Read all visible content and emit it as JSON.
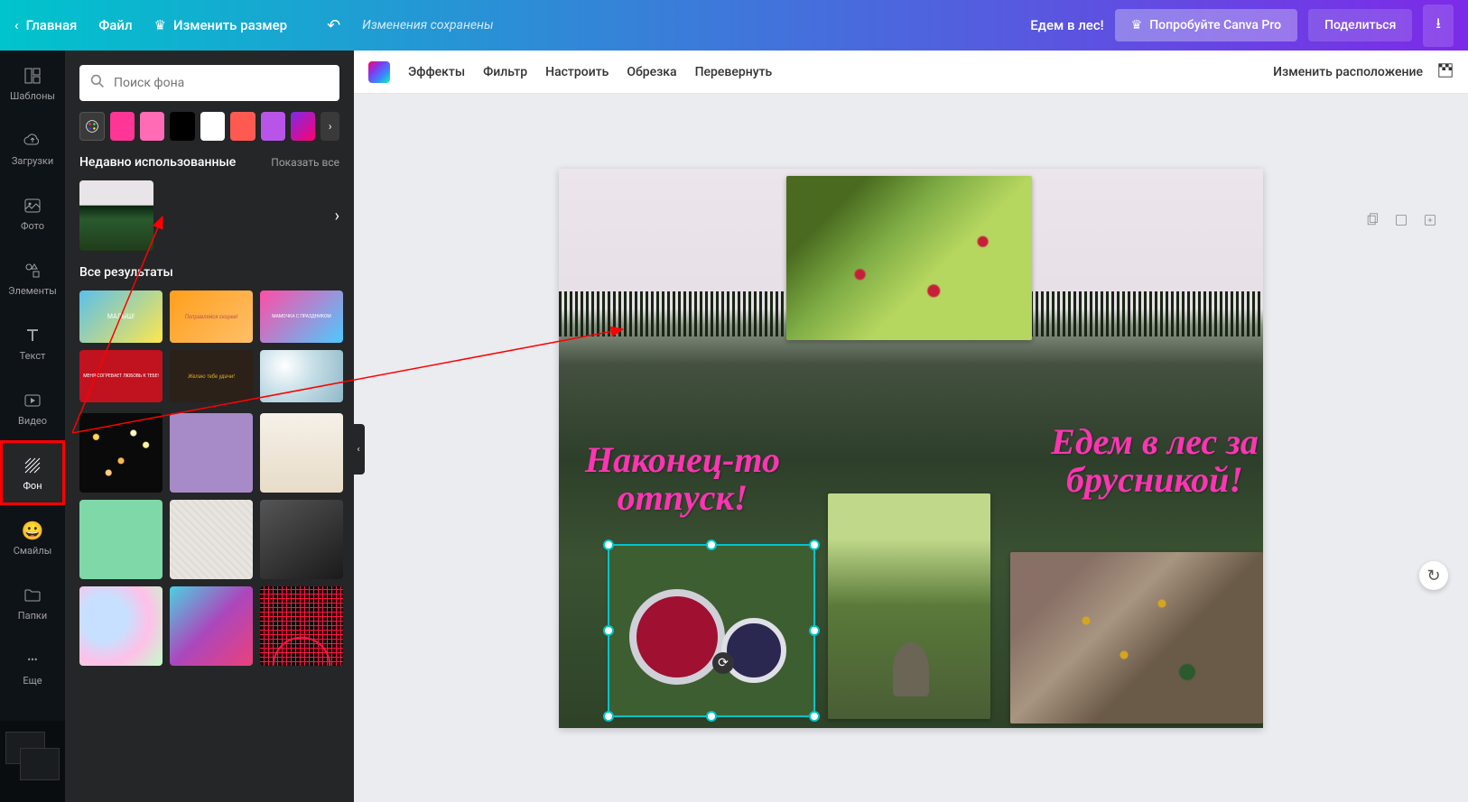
{
  "header": {
    "home": "Главная",
    "file": "Файл",
    "resize": "Изменить размер",
    "saved": "Изменения сохранены",
    "doc_name": "Едем в лес!",
    "try_pro": "Попробуйте Canva Pro",
    "share": "Поделиться"
  },
  "nav": {
    "templates": "Шаблоны",
    "uploads": "Загрузки",
    "photo": "Фото",
    "elements": "Элементы",
    "text": "Текст",
    "video": "Видео",
    "background": "Фон",
    "smileys": "Смайлы",
    "folders": "Папки",
    "more": "Еще"
  },
  "side": {
    "search_placeholder": "Поиск фона",
    "recently_used": "Недавно использованные",
    "show_all": "Показать все",
    "all_results": "Все результаты",
    "colors": [
      "#ff3696",
      "#ff6bb5",
      "#000000",
      "#ffffff",
      "#ff5a52",
      "#b855e8"
    ],
    "gradient": "linear-gradient(135deg,#7d2ae8,#ff006e)"
  },
  "toolbar": {
    "effects": "Эффекты",
    "filter": "Фильтр",
    "adjust": "Настроить",
    "crop": "Обрезка",
    "flip": "Перевернуть",
    "position": "Изменить расположение"
  },
  "canvas": {
    "text1": "Наконец-то отпуск!",
    "text2": "Едем в лес за брусникой!"
  }
}
